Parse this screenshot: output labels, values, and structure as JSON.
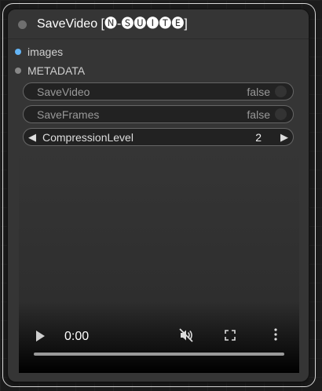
{
  "node": {
    "title": "SaveVideo [🅝-🅢🅤🅘🅣🅔]"
  },
  "inputs": [
    {
      "label": "images",
      "color": "#64b5f6"
    },
    {
      "label": "METADATA",
      "color": "#888888"
    }
  ],
  "widgets": {
    "save_video": {
      "label": "SaveVideo",
      "value": "false"
    },
    "save_frames": {
      "label": "SaveFrames",
      "value": "false"
    },
    "compression_level": {
      "label": "CompressionLevel",
      "value": "2"
    }
  },
  "video": {
    "time": "0:00",
    "progress": 0
  },
  "colors": {
    "node_bg": "#353535",
    "widget_bg": "#222222",
    "canvas_bg": "#1b1b1b"
  },
  "icons": [
    "collapse-dot-icon",
    "play-icon",
    "mute-icon",
    "fullscreen-icon",
    "more-vert-icon",
    "arrow-left-icon",
    "arrow-right-icon"
  ]
}
